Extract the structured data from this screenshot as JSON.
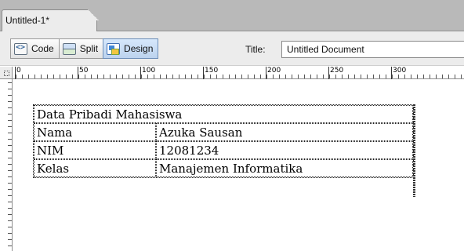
{
  "window": {
    "doc_tab": "Untitled-1*"
  },
  "toolbar": {
    "code_label": "Code",
    "split_label": "Split",
    "design_label": "Design",
    "active_view": "Design",
    "title_label": "Title:",
    "title_value": "Untitled Document"
  },
  "ruler": {
    "h_labels": [
      "0",
      "50",
      "100",
      "150",
      "200",
      "250",
      "300"
    ]
  },
  "table": {
    "header": "Data Pribadi Mahasiswa",
    "rows": [
      {
        "label": "Nama",
        "value": "Azuka Sausan"
      },
      {
        "label": "NIM",
        "value": "12081234"
      },
      {
        "label": "Kelas",
        "value": "Manajemen Informatika"
      }
    ]
  }
}
